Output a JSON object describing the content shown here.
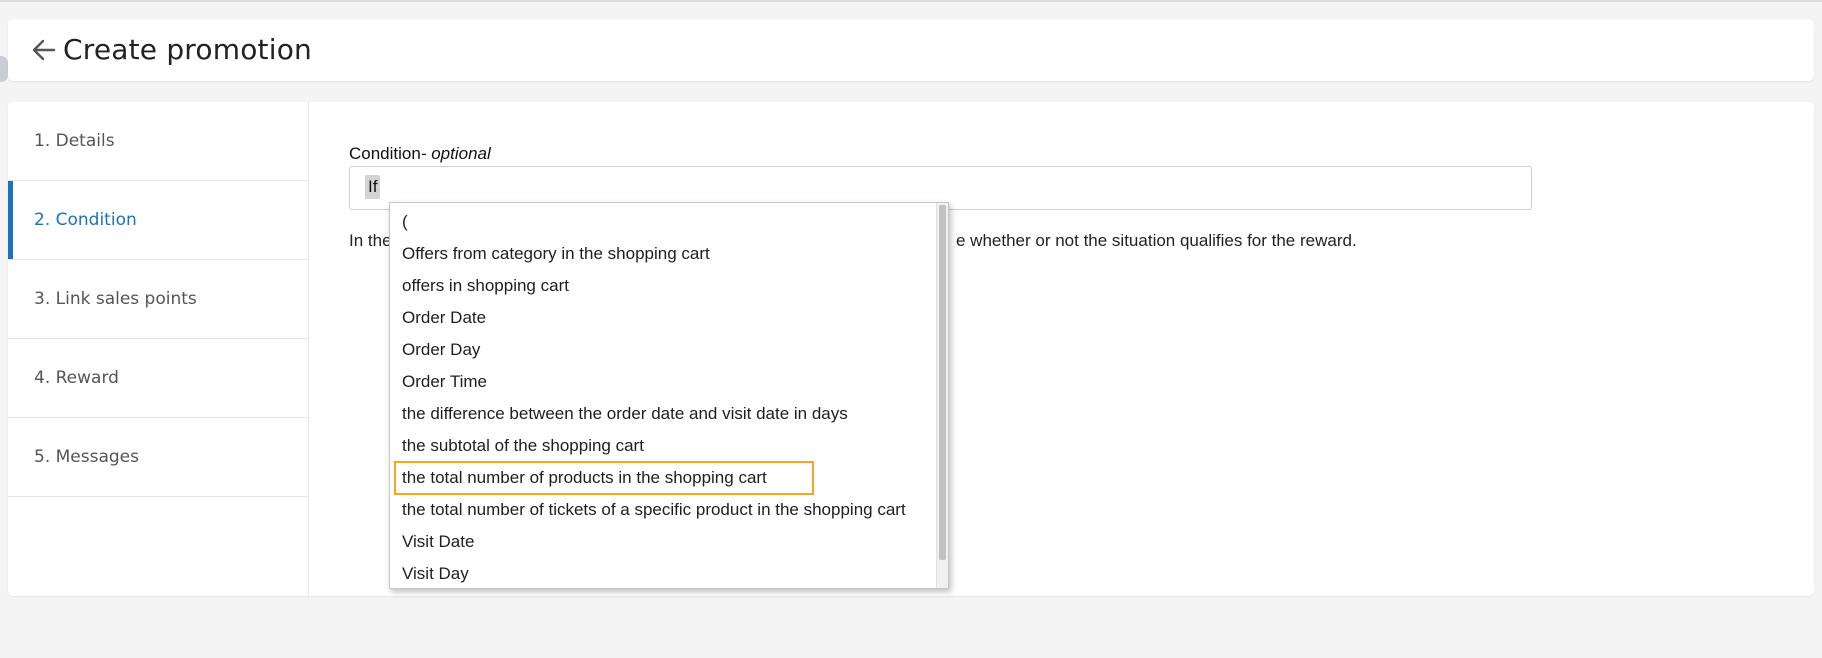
{
  "header": {
    "title": "Create promotion",
    "back_icon": "arrow-left-icon"
  },
  "steps": [
    {
      "label": "1. Details",
      "active": false
    },
    {
      "label": "2. Condition",
      "active": true
    },
    {
      "label": "3. Link sales points",
      "active": false
    },
    {
      "label": "4. Reward",
      "active": false
    },
    {
      "label": "5. Messages",
      "active": false
    }
  ],
  "condition": {
    "label": "Condition",
    "optional_text": "- optional",
    "token": "If",
    "help_text_start": "In the",
    "help_text_end": "e whether or not the situation qualifies for the reward."
  },
  "dropdown": {
    "items": [
      "(",
      "Offers from category in the shopping cart",
      "offers in shopping cart",
      "Order Date",
      "Order Day",
      "Order Time",
      "the difference between the order date and visit date in days",
      "the subtotal of the shopping cart",
      "the total number of products in the shopping cart",
      "the total number of tickets of a specific product in the shopping cart",
      "Visit Date",
      "Visit Day"
    ],
    "highlighted_index": 8
  },
  "colors": {
    "accent": "#1a73b8",
    "highlight": "#f5a623"
  }
}
